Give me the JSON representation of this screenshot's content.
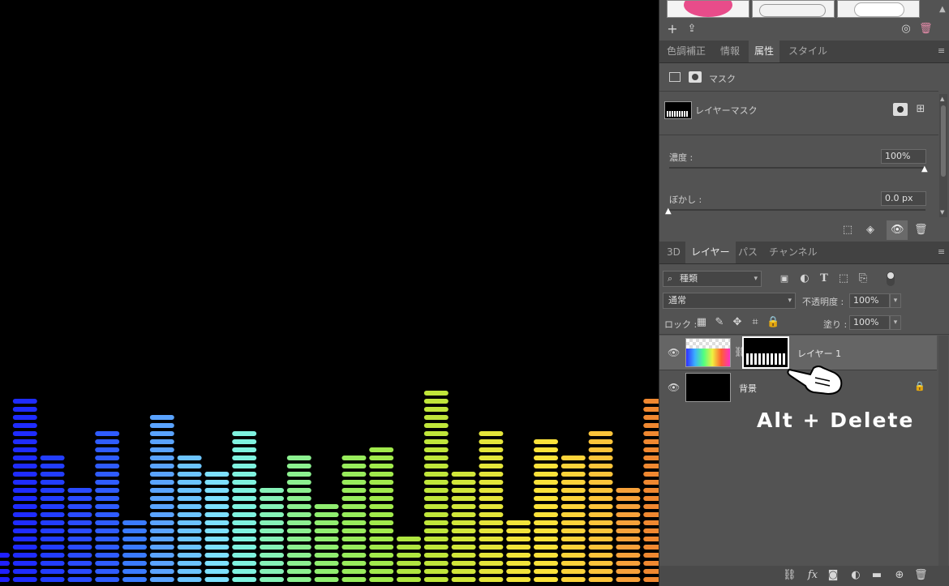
{
  "equalizer": {
    "columns": [
      {
        "level": 4,
        "color": "#2020ff"
      },
      {
        "level": 23,
        "color": "#1f2cff"
      },
      {
        "level": 16,
        "color": "#223dff"
      },
      {
        "level": 12,
        "color": "#2a4bff"
      },
      {
        "level": 19,
        "color": "#2f5cff"
      },
      {
        "level": 8,
        "color": "#3a7bff"
      },
      {
        "level": 21,
        "color": "#5aa3ff"
      },
      {
        "level": 16,
        "color": "#6cc4ff"
      },
      {
        "level": 14,
        "color": "#7de0ff"
      },
      {
        "level": 19,
        "color": "#7ff2df"
      },
      {
        "level": 12,
        "color": "#86f2b8"
      },
      {
        "level": 16,
        "color": "#8cf090"
      },
      {
        "level": 10,
        "color": "#90ee70"
      },
      {
        "level": 16,
        "color": "#98ec5c"
      },
      {
        "level": 17,
        "color": "#a1ea4c"
      },
      {
        "level": 6,
        "color": "#b0e640"
      },
      {
        "level": 24,
        "color": "#c0e63a"
      },
      {
        "level": 14,
        "color": "#d1e63a"
      },
      {
        "level": 19,
        "color": "#e4e53a"
      },
      {
        "level": 8,
        "color": "#f2e43a"
      },
      {
        "level": 18,
        "color": "#fbe23a"
      },
      {
        "level": 16,
        "color": "#fcd33a"
      },
      {
        "level": 19,
        "color": "#fcc43a"
      },
      {
        "level": 12,
        "color": "#f7a13a"
      },
      {
        "level": 23,
        "color": "#f08830"
      }
    ]
  },
  "top_toolbar": {
    "icons": [
      "plus-icon",
      "upload-icon",
      "cc-library-icon",
      "trash-icon"
    ]
  },
  "properties_panel": {
    "tabs": [
      {
        "label": "色調補正",
        "active": false
      },
      {
        "label": "情報",
        "active": false
      },
      {
        "label": "属性",
        "active": true
      },
      {
        "label": "スタイル",
        "active": false
      }
    ],
    "mask_header": "マスク",
    "layer_mask_label": "レイヤーマスク",
    "density_label": "濃度 :",
    "density_value": "100%",
    "density_fraction": 1.0,
    "feather_label": "ぼかし :",
    "feather_value": "0.0 px",
    "feather_fraction": 0.0
  },
  "layers_panel": {
    "tabs": [
      {
        "label": "3D",
        "active": false
      },
      {
        "label": "レイヤー",
        "active": true
      },
      {
        "label": "パス",
        "active": false
      },
      {
        "label": "チャンネル",
        "active": false
      }
    ],
    "filter_kind": "種類",
    "blend_mode": "通常",
    "opacity_label": "不透明度 :",
    "opacity_value": "100%",
    "lock_label": "ロック :",
    "fill_label": "塗り :",
    "fill_value": "100%",
    "layers": [
      {
        "name": "レイヤー 1",
        "selected": true
      },
      {
        "name": "背景",
        "selected": false
      }
    ],
    "shortcut_hint": "Alt + Delete"
  },
  "colors": {
    "panel_bg": "#535353",
    "tab_bar_bg": "#424242",
    "selected_layer_bg": "#656565"
  }
}
